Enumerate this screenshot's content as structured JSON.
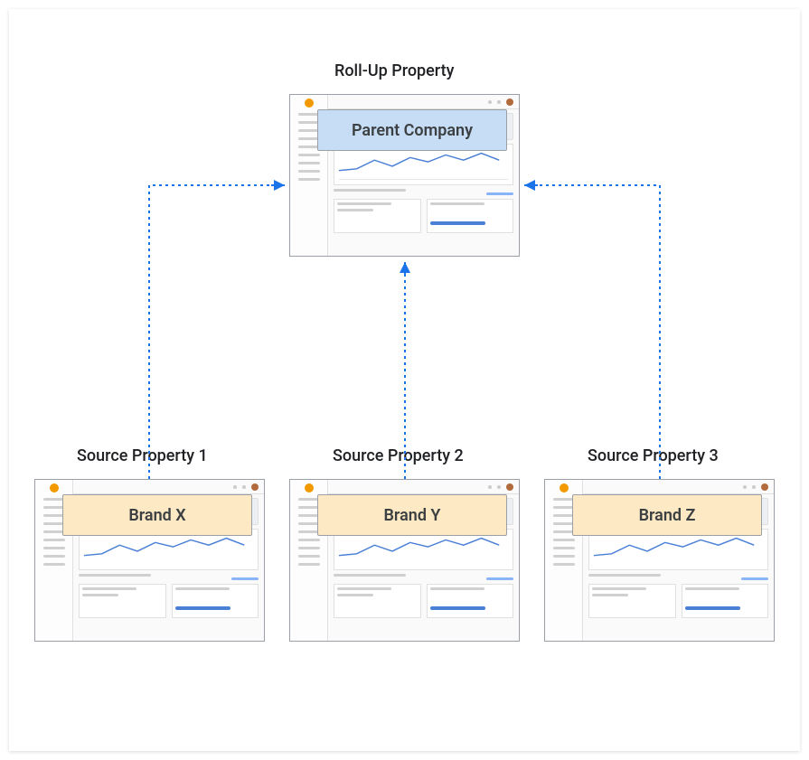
{
  "parent": {
    "title": "Roll-Up Property",
    "label": "Parent Company"
  },
  "sources": [
    {
      "title": "Source Property 1",
      "label": "Brand  X"
    },
    {
      "title": "Source Property 2",
      "label": "Brand Y"
    },
    {
      "title": "Source Property 3",
      "label": "Brand Z"
    }
  ],
  "colors": {
    "parent_bg": "#c7ddf5",
    "source_bg": "#fde9c3",
    "arrow": "#1a73e8"
  }
}
